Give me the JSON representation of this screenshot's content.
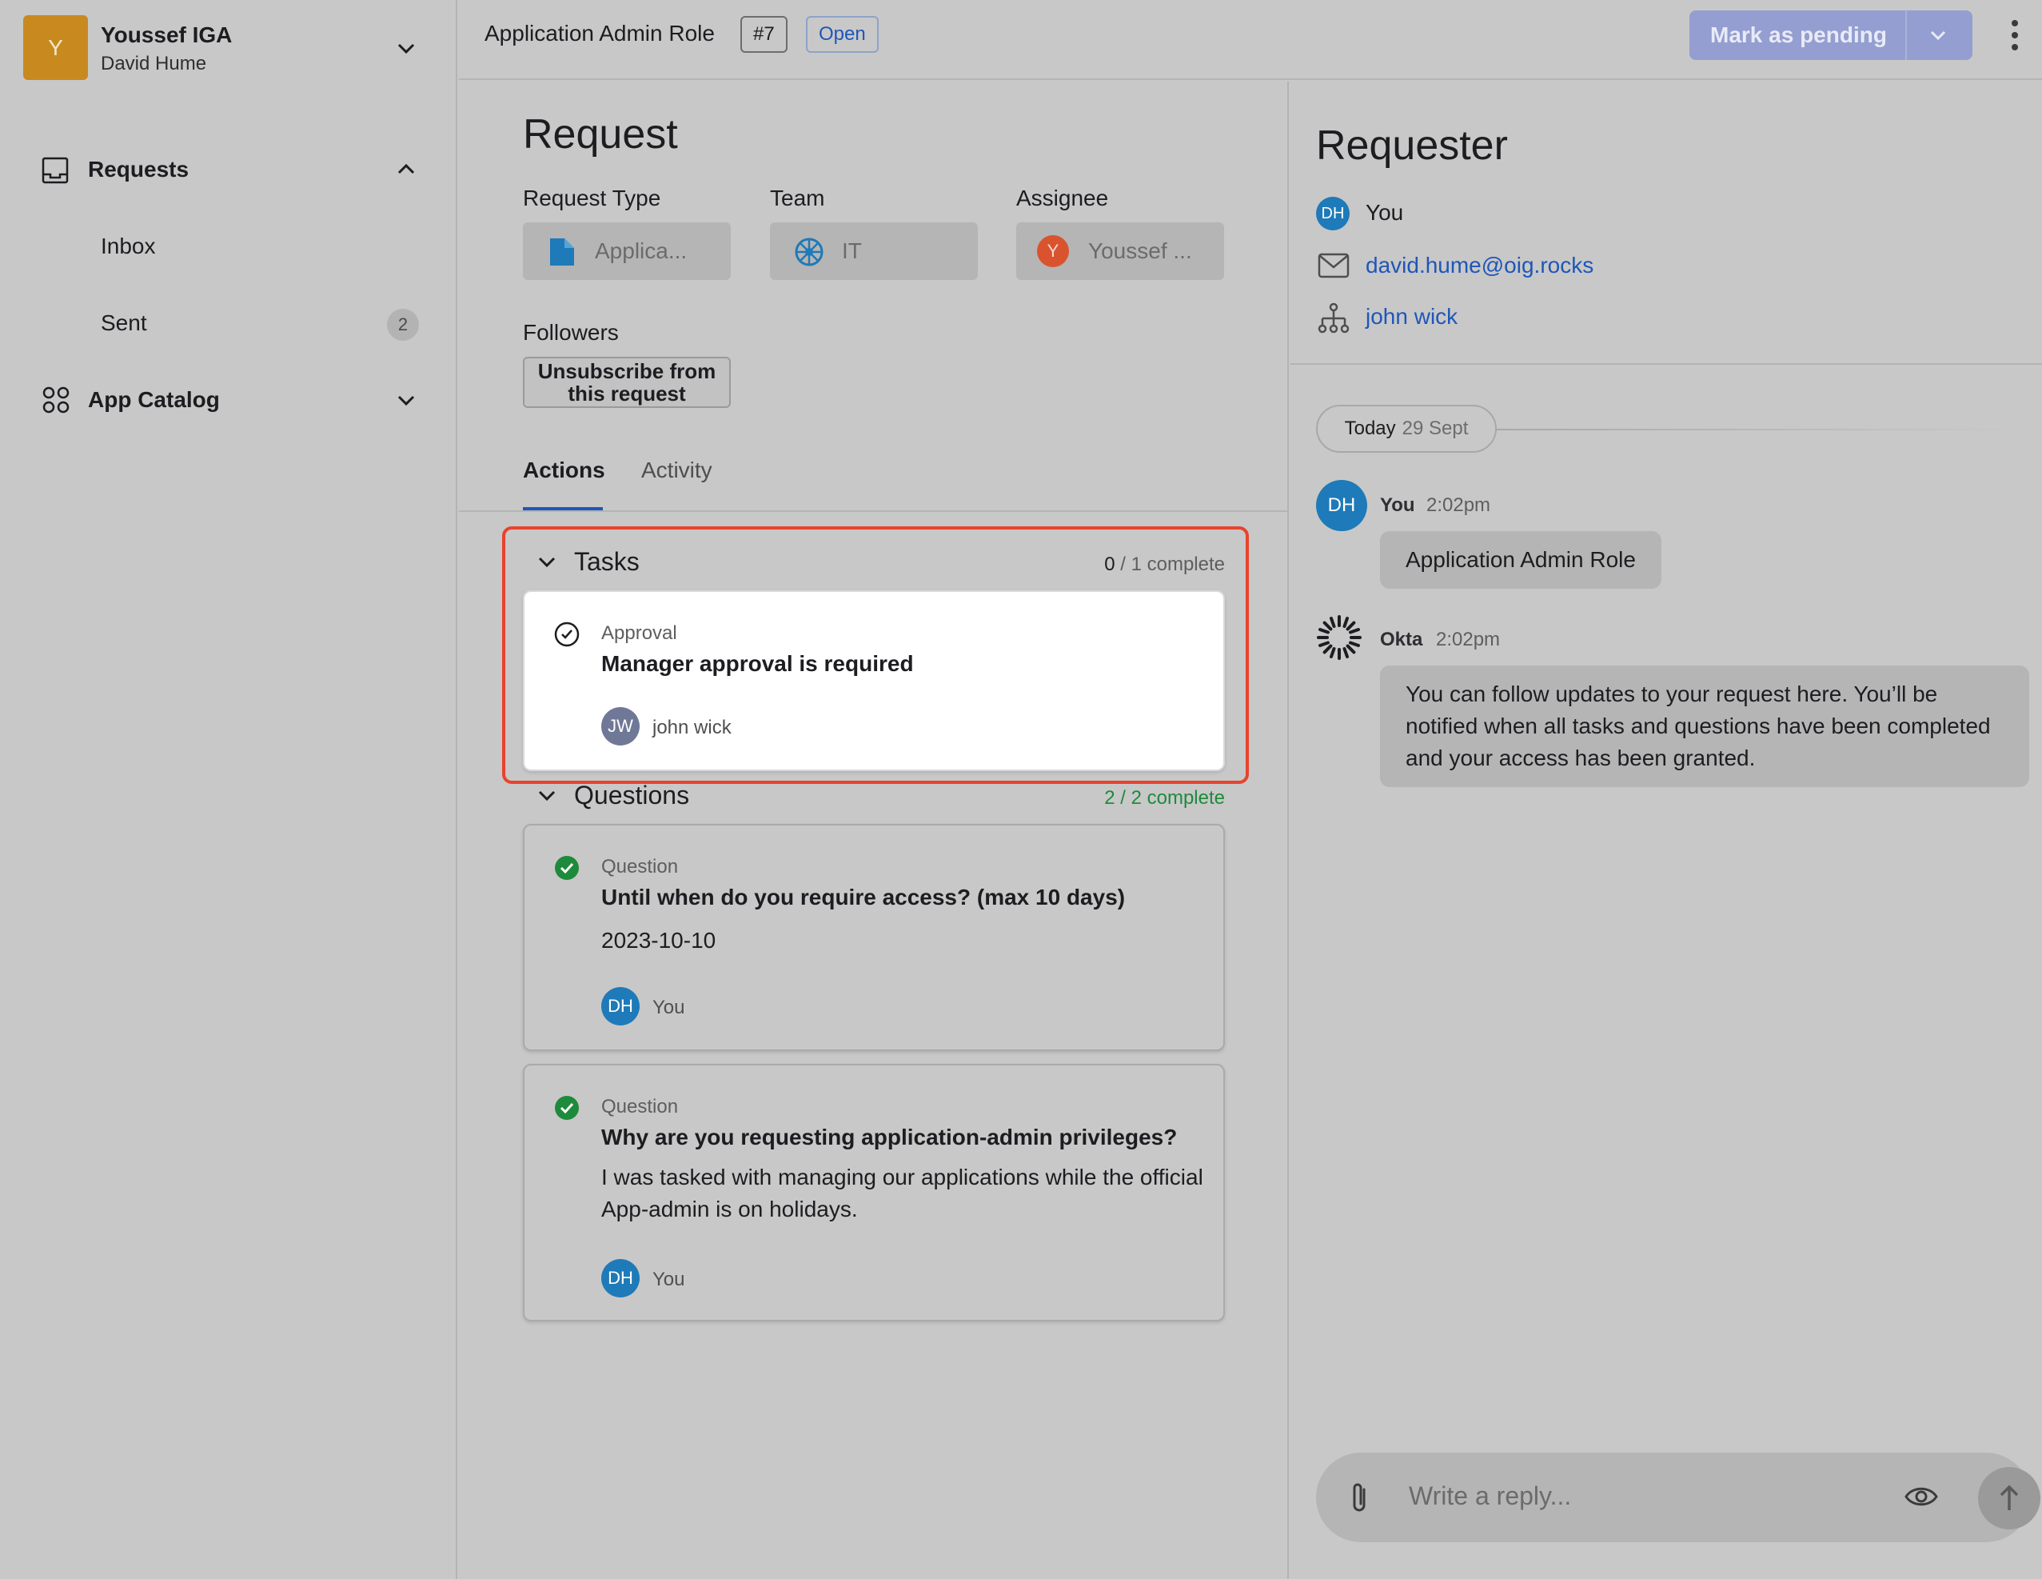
{
  "sidebar": {
    "org_initial": "Y",
    "org_name": "Youssef IGA",
    "user_name": "David Hume",
    "nav": {
      "requests_label": "Requests",
      "inbox_label": "Inbox",
      "sent_label": "Sent",
      "sent_count": "2",
      "app_catalog_label": "App Catalog"
    }
  },
  "topbar": {
    "title": "Application Admin Role",
    "number": "#7",
    "status": "Open",
    "action_label": "Mark as pending"
  },
  "request": {
    "heading": "Request",
    "request_type_label": "Request Type",
    "request_type_value": "Applica...",
    "team_label": "Team",
    "team_value": "IT",
    "assignee_label": "Assignee",
    "assignee_initial": "Y",
    "assignee_value": "Youssef ...",
    "followers_label": "Followers",
    "unsubscribe_label": "Unsubscribe from this request",
    "tabs": [
      "Actions",
      "Activity"
    ],
    "tasks": {
      "title": "Tasks",
      "count_done": "0",
      "count_rest": " / 1 complete",
      "items": [
        {
          "kind": "Approval",
          "title": "Manager approval is required",
          "assignee_initials": "JW",
          "assignee": "john wick"
        }
      ]
    },
    "questions": {
      "title": "Questions",
      "count": "2 / 2 complete",
      "items": [
        {
          "kind": "Question",
          "title": "Until when do you require access? (max 10 days)",
          "answer": "2023-10-10",
          "author_initials": "DH",
          "author": "You"
        },
        {
          "kind": "Question",
          "title": "Why are you requesting application-admin privileges?",
          "answer": "I was tasked with managing our applications while the official App-admin is on holidays.",
          "author_initials": "DH",
          "author": "You"
        }
      ]
    }
  },
  "requester": {
    "heading": "Requester",
    "initials": "DH",
    "name": "You",
    "email": "david.hume@oig.rocks",
    "manager": "john wick"
  },
  "activity": {
    "date_day": "Today",
    "date_value": "29 Sept",
    "messages": [
      {
        "initials": "DH",
        "author": "You",
        "time": "2:02pm",
        "text": "Application Admin Role"
      },
      {
        "author": "Okta",
        "time": "2:02pm",
        "text": "You can follow updates to your request here. You’ll be notified when all tasks and questions have been completed and your access has been granted."
      }
    ],
    "reply_placeholder": "Write a reply..."
  },
  "colors": {
    "accent": "#1f56b8",
    "highlight": "#e8432d",
    "success": "#1e8a3c",
    "avatar_blue": "#1e7ab8",
    "org_avatar": "#c88a1f"
  }
}
